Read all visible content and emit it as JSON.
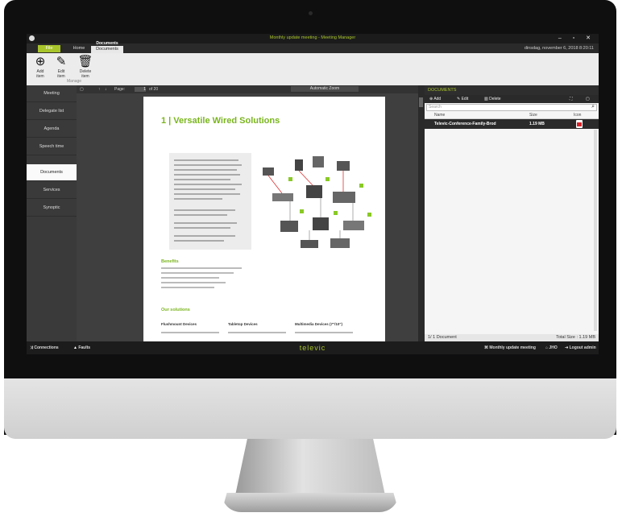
{
  "window": {
    "title": "Monthly update meeting - Meeting Manager",
    "datetime": "dinsdag, november 6, 2018 8:20:11"
  },
  "ribbon_tabs": {
    "file": "File",
    "home": "Home",
    "context_group": "Documents",
    "active": "Documents"
  },
  "ribbon": {
    "add": {
      "label": "Add\nitem",
      "icon": "plus-circle-icon"
    },
    "edit": {
      "label": "Edit\nitem",
      "icon": "pencil-icon"
    },
    "delete": {
      "label": "Delete\nitem",
      "icon": "trash-icon"
    },
    "group_name": "Manage"
  },
  "sidebar": {
    "items": [
      "Meeting",
      "Delegate list",
      "Agenda",
      "Speech time",
      "Documents",
      "Services",
      "Synoptic"
    ],
    "active_index": 4
  },
  "viewer": {
    "page_label": "Page:",
    "page_number": "1",
    "page_total": "of 20",
    "zoom": "Automatic Zoom",
    "doc": {
      "title": "1 |  Versatile Wired Solutions",
      "benefits_heading": "Benefits",
      "solutions_heading": "Our solutions",
      "columns": [
        "Flushmount Devices",
        "Tabletop Devices",
        "Multimedia Devices (7\"/10\")"
      ]
    }
  },
  "documents_panel": {
    "header": "DOCUMENTS",
    "toolbar": {
      "add": "Add",
      "edit": "Edit",
      "delete": "Delete"
    },
    "search_placeholder": "Search",
    "columns": {
      "name": "Name",
      "size": "Size",
      "icon": "Icon"
    },
    "rows": [
      {
        "name": "Televic-Conference-Family-Brochure.pdf",
        "name_display": "Televic-Conference-Family-Brod",
        "size": "1.19 MB",
        "icon": "pdf-icon"
      }
    ],
    "footer_count": "1/ 1 Document",
    "footer_total": "Total Size : 1.19 MB"
  },
  "statusbar": {
    "connections": "Connections",
    "faults": "Faults",
    "brand": "televic",
    "meeting": "Monthly update meeting",
    "home": "JHO",
    "logout": "Logout admin"
  },
  "colors": {
    "accent": "#a8c42b",
    "pdf_red": "#d8262c"
  }
}
